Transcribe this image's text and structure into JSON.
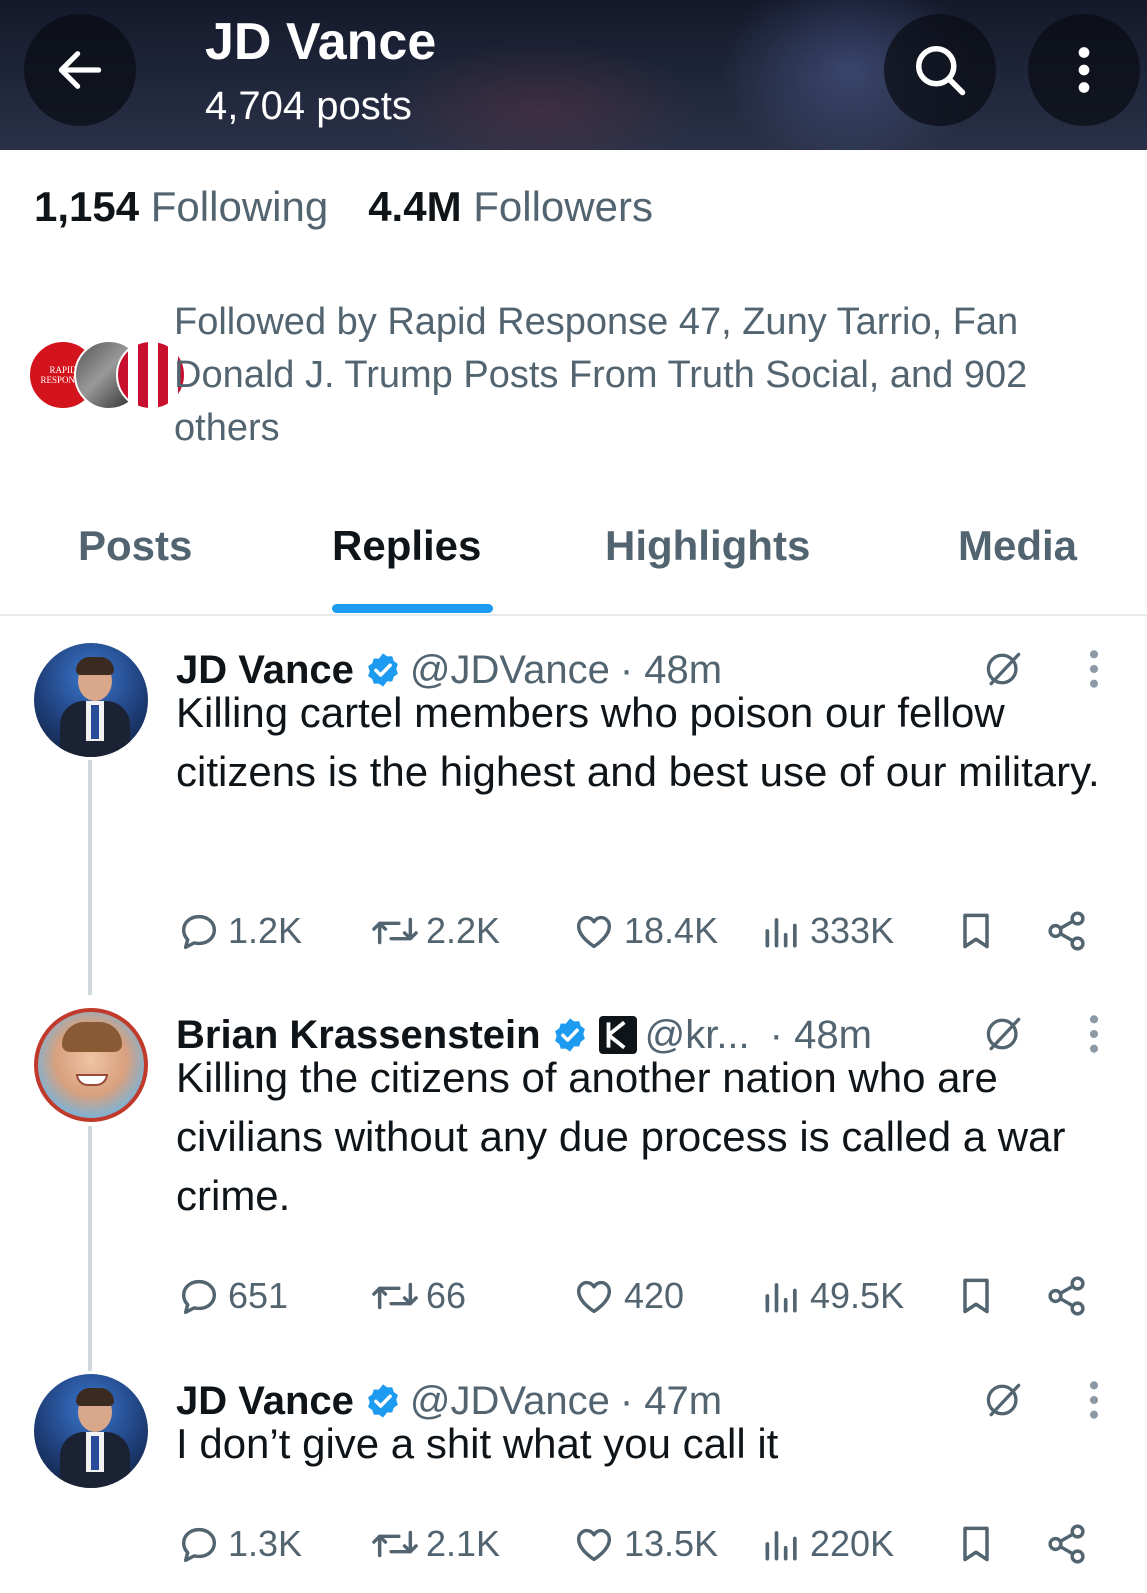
{
  "header": {
    "name": "JD Vance",
    "posts_count": "4,704 posts",
    "icons": [
      "arrow-left-icon",
      "search-icon",
      "vertical-ellipsis-icon"
    ]
  },
  "stats": {
    "following_count": "1,154",
    "following_label": "Following",
    "followers_count": "4.4M",
    "followers_label": "Followers"
  },
  "followed_by": {
    "text": "Followed by Rapid Response 47, Zuny Tarrio, Fan Donald J. Trump Posts From Truth Social, and 902 others",
    "avatar_text": [
      "RAPID",
      "RESPONSE"
    ]
  },
  "tabs": [
    {
      "label": "Posts",
      "active": false
    },
    {
      "label": "Replies",
      "active": true
    },
    {
      "label": "Highlights",
      "active": false
    },
    {
      "label": "Media",
      "active": false
    }
  ],
  "colors": {
    "accent": "#1d9bf0",
    "text_primary": "#0f1419",
    "text_secondary": "#536471",
    "divider": "#e6eaed",
    "thread_line": "#cfd9de"
  },
  "tweets": [
    {
      "name": "JD Vance",
      "handle": "@JDVance",
      "time": "· 48m",
      "text": "Killing cartel members who poison our fellow citizens is the highest and best use of our military.",
      "replies": "1.2K",
      "reposts": "2.2K",
      "likes": "18.4K",
      "views": "333K"
    },
    {
      "name": "Brian Krassenstein",
      "handle": "@kr...",
      "time": "· 48m",
      "text": "Killing the citizens of another nation who are civilians without any due process is called a war crime.",
      "replies": "651",
      "reposts": "66",
      "likes": "420",
      "views": "49.5K"
    },
    {
      "name": "JD Vance",
      "handle": "@JDVance",
      "time": "· 47m",
      "text": "I don’t give a shit what you call it",
      "replies": "1.3K",
      "reposts": "2.1K",
      "likes": "13.5K",
      "views": "220K"
    }
  ]
}
